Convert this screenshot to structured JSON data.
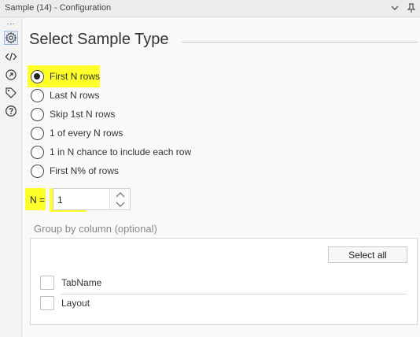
{
  "window": {
    "title": "Sample (14) - Configuration"
  },
  "sidebar": {
    "items": [
      {
        "icon": "gear-icon"
      },
      {
        "icon": "code-icon"
      },
      {
        "icon": "connection-icon"
      },
      {
        "icon": "tag-icon"
      },
      {
        "icon": "help-icon"
      }
    ]
  },
  "main": {
    "heading": "Select Sample Type",
    "options": [
      {
        "label": "First N rows",
        "selected": true
      },
      {
        "label": "Last N rows",
        "selected": false
      },
      {
        "label": "Skip 1st N rows",
        "selected": false
      },
      {
        "label": "1 of every N rows",
        "selected": false
      },
      {
        "label": "1 in N chance to include each row",
        "selected": false
      },
      {
        "label": "First N% of rows",
        "selected": false
      }
    ],
    "n_label": "N =",
    "n_value": "1",
    "group": {
      "label": "Group by column (optional)",
      "select_all": "Select all",
      "columns": [
        {
          "label": "TabName",
          "checked": false
        },
        {
          "label": "Layout",
          "checked": false
        }
      ]
    }
  },
  "colors": {
    "highlight": "#ffff29",
    "accent": "#4a90d9"
  }
}
